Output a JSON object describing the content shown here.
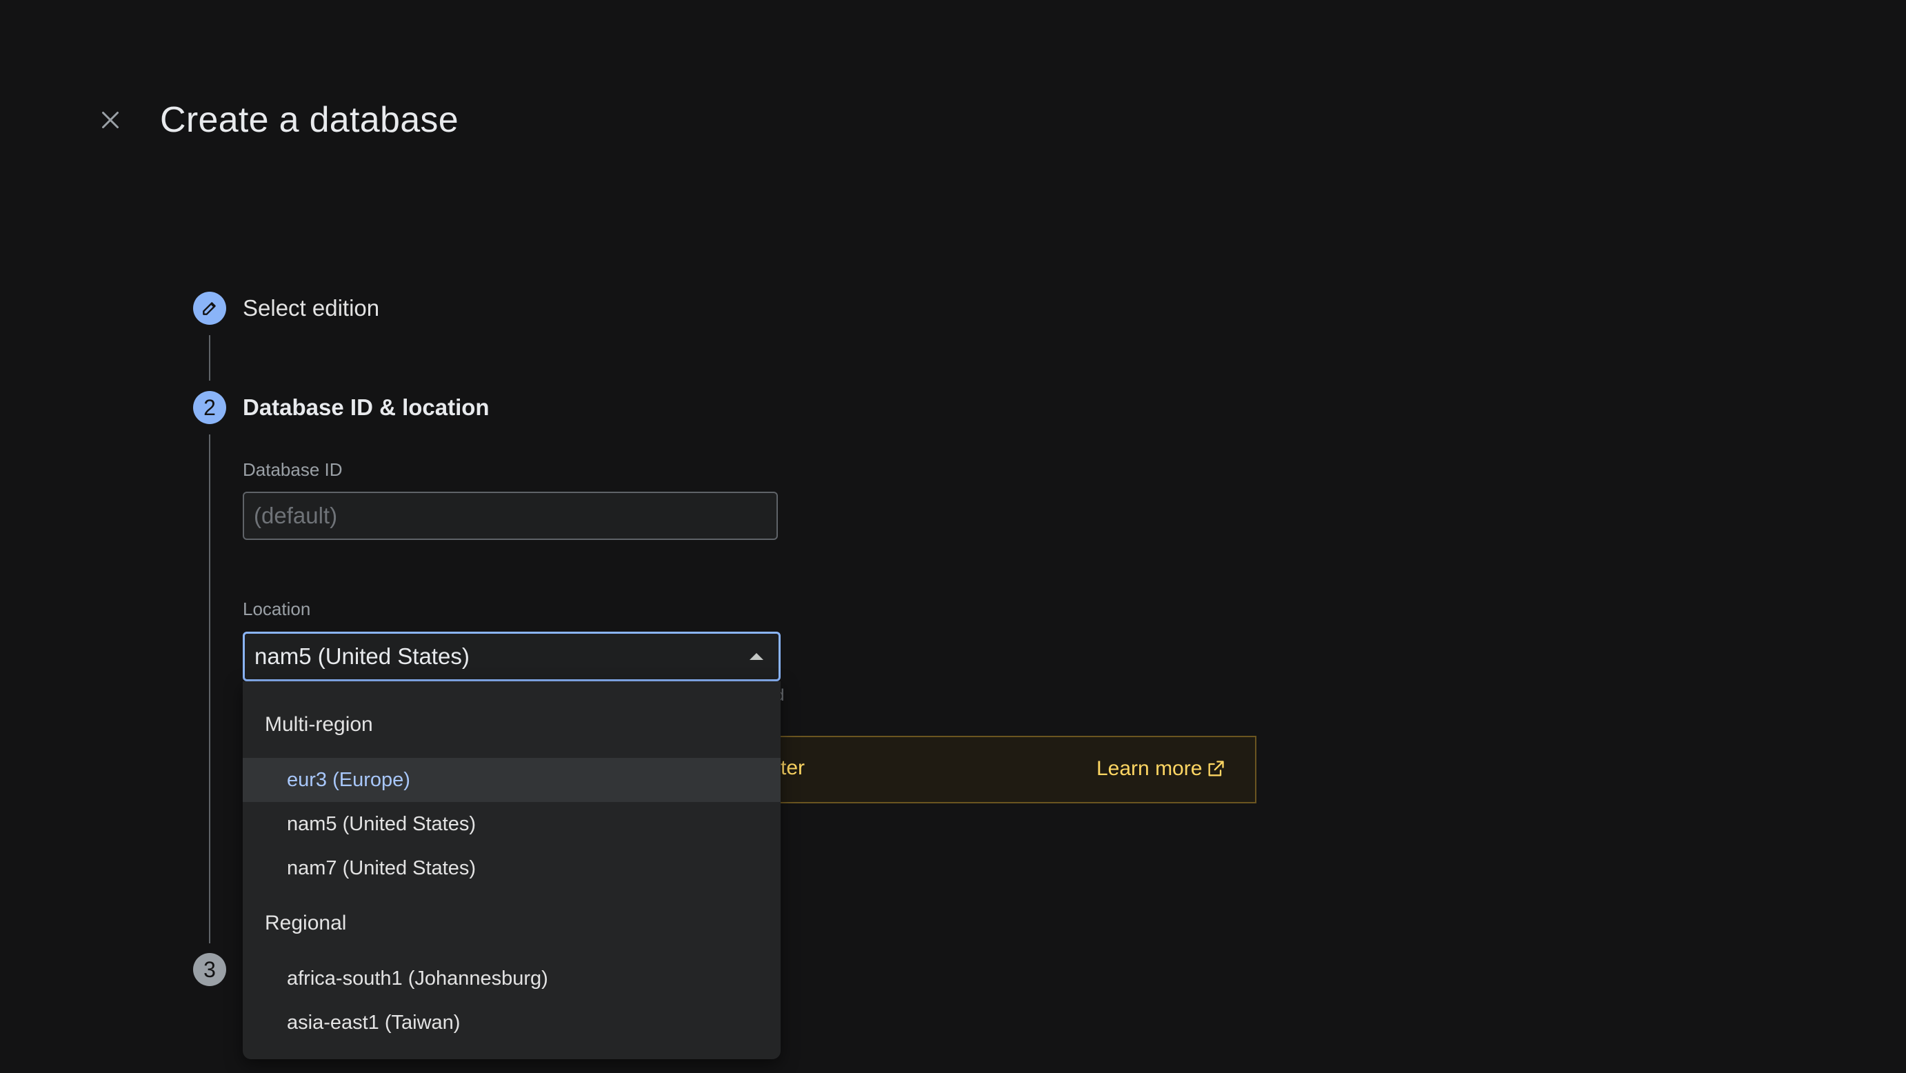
{
  "header": {
    "title": "Create a database",
    "close_icon": "close-icon"
  },
  "stepper": {
    "steps": [
      {
        "number": "",
        "icon": "pencil-icon",
        "label": "Select edition",
        "state": "completed"
      },
      {
        "number": "2",
        "label": "Database ID & location",
        "state": "active"
      },
      {
        "number": "3",
        "label": "",
        "state": "inactive"
      }
    ]
  },
  "form": {
    "database_id": {
      "label": "Database ID",
      "placeholder": "(default)",
      "value": ""
    },
    "location": {
      "label": "Location",
      "selected": "nam5 (United States)",
      "hint_fragment": "d"
    }
  },
  "banner": {
    "text_fragment": "ter",
    "link_label": "Learn more",
    "link_icon": "external-link-icon"
  },
  "dropdown": {
    "groups": [
      {
        "header": "Multi-region",
        "options": [
          {
            "label": "eur3 (Europe)",
            "highlighted": true
          },
          {
            "label": "nam5 (United States)",
            "highlighted": false
          },
          {
            "label": "nam7 (United States)",
            "highlighted": false
          }
        ]
      },
      {
        "header": "Regional",
        "options": [
          {
            "label": "africa-south1 (Johannesburg)",
            "highlighted": false
          },
          {
            "label": "asia-east1 (Taiwan)",
            "highlighted": false
          }
        ]
      }
    ]
  },
  "colors": {
    "background": "#131314",
    "accent": "#8ab4f8",
    "warning": "#fdd663"
  }
}
